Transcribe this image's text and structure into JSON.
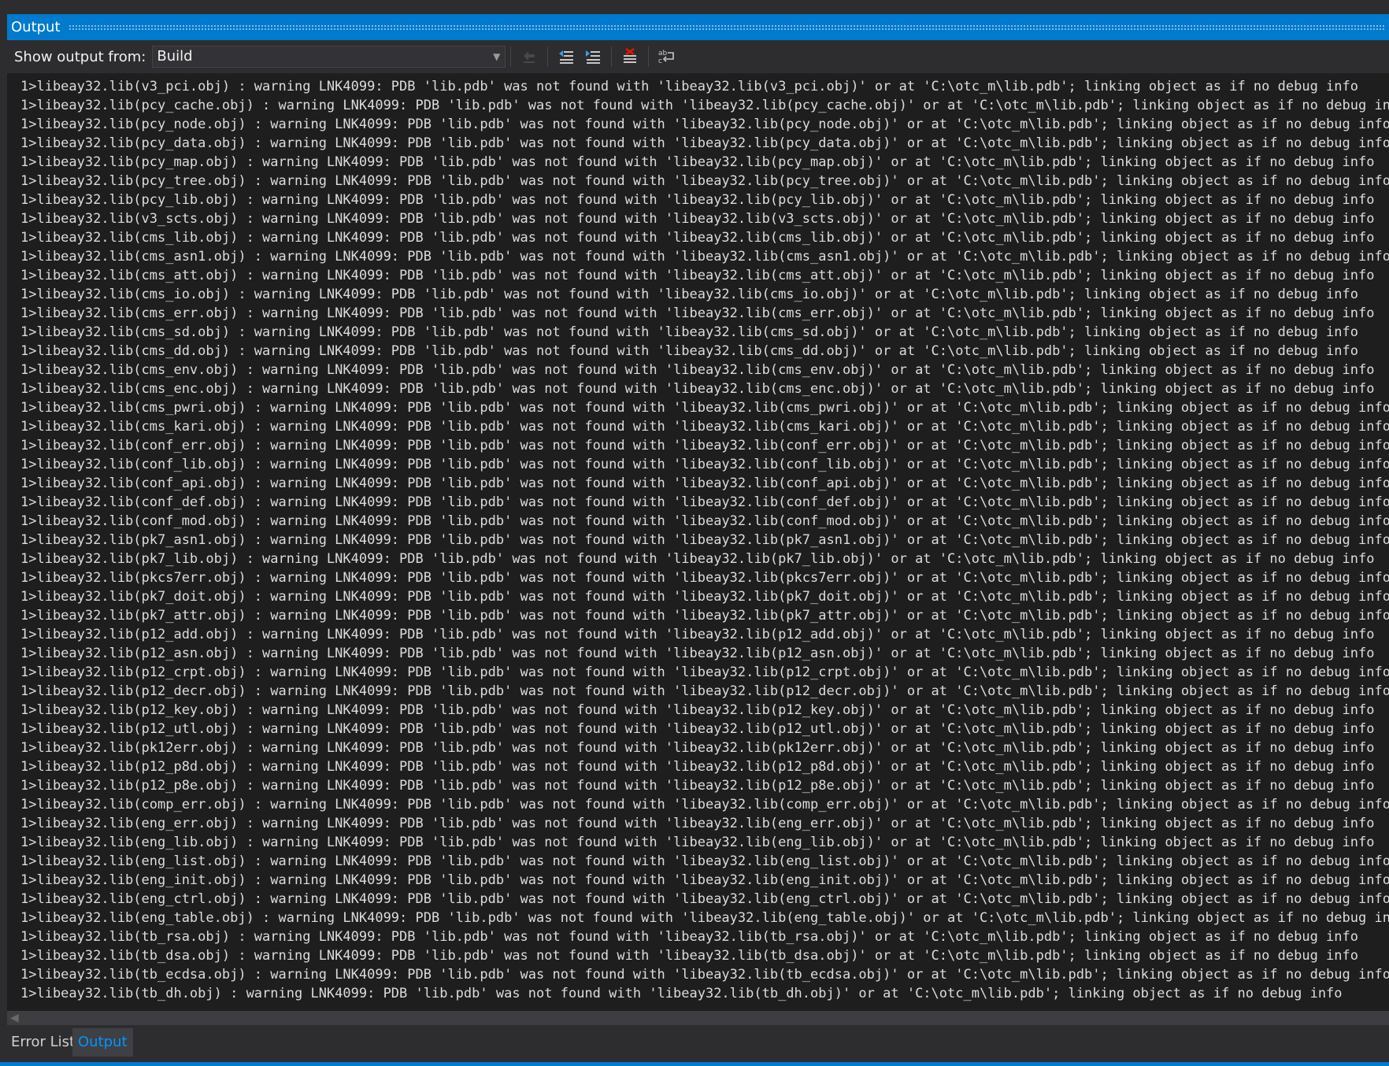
{
  "panel": {
    "title": "Output"
  },
  "toolbar": {
    "show_output_label": "Show output from:",
    "source_value": "Build",
    "buttons": [
      {
        "name": "go-to-message-icon",
        "enabled": false
      },
      {
        "name": "previous-message-icon",
        "enabled": true
      },
      {
        "name": "next-message-icon",
        "enabled": true
      },
      {
        "name": "clear-all-icon",
        "enabled": true
      },
      {
        "name": "word-wrap-icon",
        "enabled": true
      }
    ]
  },
  "output": {
    "lines": [
      "1>libeay32.lib(v3_pci.obj) : warning LNK4099: PDB 'lib.pdb' was not found with 'libeay32.lib(v3_pci.obj)' or at 'C:\\otc_m\\lib.pdb'; linking object as if no debug info",
      "1>libeay32.lib(pcy_cache.obj) : warning LNK4099: PDB 'lib.pdb' was not found with 'libeay32.lib(pcy_cache.obj)' or at 'C:\\otc_m\\lib.pdb'; linking object as if no debug info",
      "1>libeay32.lib(pcy_node.obj) : warning LNK4099: PDB 'lib.pdb' was not found with 'libeay32.lib(pcy_node.obj)' or at 'C:\\otc_m\\lib.pdb'; linking object as if no debug info",
      "1>libeay32.lib(pcy_data.obj) : warning LNK4099: PDB 'lib.pdb' was not found with 'libeay32.lib(pcy_data.obj)' or at 'C:\\otc_m\\lib.pdb'; linking object as if no debug info",
      "1>libeay32.lib(pcy_map.obj) : warning LNK4099: PDB 'lib.pdb' was not found with 'libeay32.lib(pcy_map.obj)' or at 'C:\\otc_m\\lib.pdb'; linking object as if no debug info",
      "1>libeay32.lib(pcy_tree.obj) : warning LNK4099: PDB 'lib.pdb' was not found with 'libeay32.lib(pcy_tree.obj)' or at 'C:\\otc_m\\lib.pdb'; linking object as if no debug info",
      "1>libeay32.lib(pcy_lib.obj) : warning LNK4099: PDB 'lib.pdb' was not found with 'libeay32.lib(pcy_lib.obj)' or at 'C:\\otc_m\\lib.pdb'; linking object as if no debug info",
      "1>libeay32.lib(v3_scts.obj) : warning LNK4099: PDB 'lib.pdb' was not found with 'libeay32.lib(v3_scts.obj)' or at 'C:\\otc_m\\lib.pdb'; linking object as if no debug info",
      "1>libeay32.lib(cms_lib.obj) : warning LNK4099: PDB 'lib.pdb' was not found with 'libeay32.lib(cms_lib.obj)' or at 'C:\\otc_m\\lib.pdb'; linking object as if no debug info",
      "1>libeay32.lib(cms_asn1.obj) : warning LNK4099: PDB 'lib.pdb' was not found with 'libeay32.lib(cms_asn1.obj)' or at 'C:\\otc_m\\lib.pdb'; linking object as if no debug info",
      "1>libeay32.lib(cms_att.obj) : warning LNK4099: PDB 'lib.pdb' was not found with 'libeay32.lib(cms_att.obj)' or at 'C:\\otc_m\\lib.pdb'; linking object as if no debug info",
      "1>libeay32.lib(cms_io.obj) : warning LNK4099: PDB 'lib.pdb' was not found with 'libeay32.lib(cms_io.obj)' or at 'C:\\otc_m\\lib.pdb'; linking object as if no debug info",
      "1>libeay32.lib(cms_err.obj) : warning LNK4099: PDB 'lib.pdb' was not found with 'libeay32.lib(cms_err.obj)' or at 'C:\\otc_m\\lib.pdb'; linking object as if no debug info",
      "1>libeay32.lib(cms_sd.obj) : warning LNK4099: PDB 'lib.pdb' was not found with 'libeay32.lib(cms_sd.obj)' or at 'C:\\otc_m\\lib.pdb'; linking object as if no debug info",
      "1>libeay32.lib(cms_dd.obj) : warning LNK4099: PDB 'lib.pdb' was not found with 'libeay32.lib(cms_dd.obj)' or at 'C:\\otc_m\\lib.pdb'; linking object as if no debug info",
      "1>libeay32.lib(cms_env.obj) : warning LNK4099: PDB 'lib.pdb' was not found with 'libeay32.lib(cms_env.obj)' or at 'C:\\otc_m\\lib.pdb'; linking object as if no debug info",
      "1>libeay32.lib(cms_enc.obj) : warning LNK4099: PDB 'lib.pdb' was not found with 'libeay32.lib(cms_enc.obj)' or at 'C:\\otc_m\\lib.pdb'; linking object as if no debug info",
      "1>libeay32.lib(cms_pwri.obj) : warning LNK4099: PDB 'lib.pdb' was not found with 'libeay32.lib(cms_pwri.obj)' or at 'C:\\otc_m\\lib.pdb'; linking object as if no debug info",
      "1>libeay32.lib(cms_kari.obj) : warning LNK4099: PDB 'lib.pdb' was not found with 'libeay32.lib(cms_kari.obj)' or at 'C:\\otc_m\\lib.pdb'; linking object as if no debug info",
      "1>libeay32.lib(conf_err.obj) : warning LNK4099: PDB 'lib.pdb' was not found with 'libeay32.lib(conf_err.obj)' or at 'C:\\otc_m\\lib.pdb'; linking object as if no debug info",
      "1>libeay32.lib(conf_lib.obj) : warning LNK4099: PDB 'lib.pdb' was not found with 'libeay32.lib(conf_lib.obj)' or at 'C:\\otc_m\\lib.pdb'; linking object as if no debug info",
      "1>libeay32.lib(conf_api.obj) : warning LNK4099: PDB 'lib.pdb' was not found with 'libeay32.lib(conf_api.obj)' or at 'C:\\otc_m\\lib.pdb'; linking object as if no debug info",
      "1>libeay32.lib(conf_def.obj) : warning LNK4099: PDB 'lib.pdb' was not found with 'libeay32.lib(conf_def.obj)' or at 'C:\\otc_m\\lib.pdb'; linking object as if no debug info",
      "1>libeay32.lib(conf_mod.obj) : warning LNK4099: PDB 'lib.pdb' was not found with 'libeay32.lib(conf_mod.obj)' or at 'C:\\otc_m\\lib.pdb'; linking object as if no debug info",
      "1>libeay32.lib(pk7_asn1.obj) : warning LNK4099: PDB 'lib.pdb' was not found with 'libeay32.lib(pk7_asn1.obj)' or at 'C:\\otc_m\\lib.pdb'; linking object as if no debug info",
      "1>libeay32.lib(pk7_lib.obj) : warning LNK4099: PDB 'lib.pdb' was not found with 'libeay32.lib(pk7_lib.obj)' or at 'C:\\otc_m\\lib.pdb'; linking object as if no debug info",
      "1>libeay32.lib(pkcs7err.obj) : warning LNK4099: PDB 'lib.pdb' was not found with 'libeay32.lib(pkcs7err.obj)' or at 'C:\\otc_m\\lib.pdb'; linking object as if no debug info",
      "1>libeay32.lib(pk7_doit.obj) : warning LNK4099: PDB 'lib.pdb' was not found with 'libeay32.lib(pk7_doit.obj)' or at 'C:\\otc_m\\lib.pdb'; linking object as if no debug info",
      "1>libeay32.lib(pk7_attr.obj) : warning LNK4099: PDB 'lib.pdb' was not found with 'libeay32.lib(pk7_attr.obj)' or at 'C:\\otc_m\\lib.pdb'; linking object as if no debug info",
      "1>libeay32.lib(p12_add.obj) : warning LNK4099: PDB 'lib.pdb' was not found with 'libeay32.lib(p12_add.obj)' or at 'C:\\otc_m\\lib.pdb'; linking object as if no debug info",
      "1>libeay32.lib(p12_asn.obj) : warning LNK4099: PDB 'lib.pdb' was not found with 'libeay32.lib(p12_asn.obj)' or at 'C:\\otc_m\\lib.pdb'; linking object as if no debug info",
      "1>libeay32.lib(p12_crpt.obj) : warning LNK4099: PDB 'lib.pdb' was not found with 'libeay32.lib(p12_crpt.obj)' or at 'C:\\otc_m\\lib.pdb'; linking object as if no debug info",
      "1>libeay32.lib(p12_decr.obj) : warning LNK4099: PDB 'lib.pdb' was not found with 'libeay32.lib(p12_decr.obj)' or at 'C:\\otc_m\\lib.pdb'; linking object as if no debug info",
      "1>libeay32.lib(p12_key.obj) : warning LNK4099: PDB 'lib.pdb' was not found with 'libeay32.lib(p12_key.obj)' or at 'C:\\otc_m\\lib.pdb'; linking object as if no debug info",
      "1>libeay32.lib(p12_utl.obj) : warning LNK4099: PDB 'lib.pdb' was not found with 'libeay32.lib(p12_utl.obj)' or at 'C:\\otc_m\\lib.pdb'; linking object as if no debug info",
      "1>libeay32.lib(pk12err.obj) : warning LNK4099: PDB 'lib.pdb' was not found with 'libeay32.lib(pk12err.obj)' or at 'C:\\otc_m\\lib.pdb'; linking object as if no debug info",
      "1>libeay32.lib(p12_p8d.obj) : warning LNK4099: PDB 'lib.pdb' was not found with 'libeay32.lib(p12_p8d.obj)' or at 'C:\\otc_m\\lib.pdb'; linking object as if no debug info",
      "1>libeay32.lib(p12_p8e.obj) : warning LNK4099: PDB 'lib.pdb' was not found with 'libeay32.lib(p12_p8e.obj)' or at 'C:\\otc_m\\lib.pdb'; linking object as if no debug info",
      "1>libeay32.lib(comp_err.obj) : warning LNK4099: PDB 'lib.pdb' was not found with 'libeay32.lib(comp_err.obj)' or at 'C:\\otc_m\\lib.pdb'; linking object as if no debug info",
      "1>libeay32.lib(eng_err.obj) : warning LNK4099: PDB 'lib.pdb' was not found with 'libeay32.lib(eng_err.obj)' or at 'C:\\otc_m\\lib.pdb'; linking object as if no debug info",
      "1>libeay32.lib(eng_lib.obj) : warning LNK4099: PDB 'lib.pdb' was not found with 'libeay32.lib(eng_lib.obj)' or at 'C:\\otc_m\\lib.pdb'; linking object as if no debug info",
      "1>libeay32.lib(eng_list.obj) : warning LNK4099: PDB 'lib.pdb' was not found with 'libeay32.lib(eng_list.obj)' or at 'C:\\otc_m\\lib.pdb'; linking object as if no debug info",
      "1>libeay32.lib(eng_init.obj) : warning LNK4099: PDB 'lib.pdb' was not found with 'libeay32.lib(eng_init.obj)' or at 'C:\\otc_m\\lib.pdb'; linking object as if no debug info",
      "1>libeay32.lib(eng_ctrl.obj) : warning LNK4099: PDB 'lib.pdb' was not found with 'libeay32.lib(eng_ctrl.obj)' or at 'C:\\otc_m\\lib.pdb'; linking object as if no debug info",
      "1>libeay32.lib(eng_table.obj) : warning LNK4099: PDB 'lib.pdb' was not found with 'libeay32.lib(eng_table.obj)' or at 'C:\\otc_m\\lib.pdb'; linking object as if no debug info",
      "1>libeay32.lib(tb_rsa.obj) : warning LNK4099: PDB 'lib.pdb' was not found with 'libeay32.lib(tb_rsa.obj)' or at 'C:\\otc_m\\lib.pdb'; linking object as if no debug info",
      "1>libeay32.lib(tb_dsa.obj) : warning LNK4099: PDB 'lib.pdb' was not found with 'libeay32.lib(tb_dsa.obj)' or at 'C:\\otc_m\\lib.pdb'; linking object as if no debug info",
      "1>libeay32.lib(tb_ecdsa.obj) : warning LNK4099: PDB 'lib.pdb' was not found with 'libeay32.lib(tb_ecdsa.obj)' or at 'C:\\otc_m\\lib.pdb'; linking object as if no debug info",
      "1>libeay32.lib(tb_dh.obj) : warning LNK4099: PDB 'lib.pdb' was not found with 'libeay32.lib(tb_dh.obj)' or at 'C:\\otc_m\\lib.pdb'; linking object as if no debug info"
    ]
  },
  "tabs": [
    {
      "label": "Error List",
      "active": false
    },
    {
      "label": "Output",
      "active": true
    }
  ],
  "colors": {
    "accent": "#007acc",
    "background": "#2d2d30",
    "editor_background": "#1e1e1e",
    "text": "#dcdcdc",
    "active_tab_text": "#0097fb"
  }
}
